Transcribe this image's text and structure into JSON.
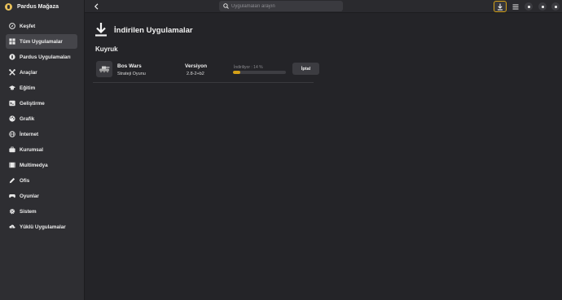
{
  "app": {
    "title": "Pardus Mağaza"
  },
  "sidebar": {
    "items": [
      {
        "label": "Keşfet",
        "icon": "compass-icon"
      },
      {
        "label": "Tüm Uygulamalar",
        "icon": "grid-icon",
        "active": true
      },
      {
        "label": "Pardus Uygulamaları",
        "icon": "pardus-icon"
      },
      {
        "label": "Araçlar",
        "icon": "tools-icon"
      },
      {
        "label": "Eğitim",
        "icon": "graduation-cap-icon"
      },
      {
        "label": "Geliştirme",
        "icon": "terminal-icon"
      },
      {
        "label": "Grafik",
        "icon": "palette-icon"
      },
      {
        "label": "İnternet",
        "icon": "globe-icon"
      },
      {
        "label": "Kurumsal",
        "icon": "briefcase-icon"
      },
      {
        "label": "Multimedya",
        "icon": "film-icon"
      },
      {
        "label": "Ofis",
        "icon": "pen-icon"
      },
      {
        "label": "Oyunlar",
        "icon": "gamepad-icon"
      },
      {
        "label": "Sistem",
        "icon": "gear-icon"
      },
      {
        "label": "Yüklü Uygulamalar",
        "icon": "cloud-download-icon"
      }
    ]
  },
  "header": {
    "search_placeholder": "Uygulamaları arayın"
  },
  "main": {
    "title": "İndirilen Uygulamalar",
    "section": "Kuyruk",
    "downloads": [
      {
        "name": "Bos Wars",
        "category": "Strateji Oyunu",
        "version_label": "Versiyon",
        "version": "2.8-2+b2",
        "progress_text": "İndiriliyor : 14 %",
        "progress": 14,
        "cancel_label": "İptal"
      }
    ]
  },
  "colors": {
    "accent": "#d4a017",
    "sidebar_bg": "#2e2e32",
    "main_bg": "#242428"
  }
}
